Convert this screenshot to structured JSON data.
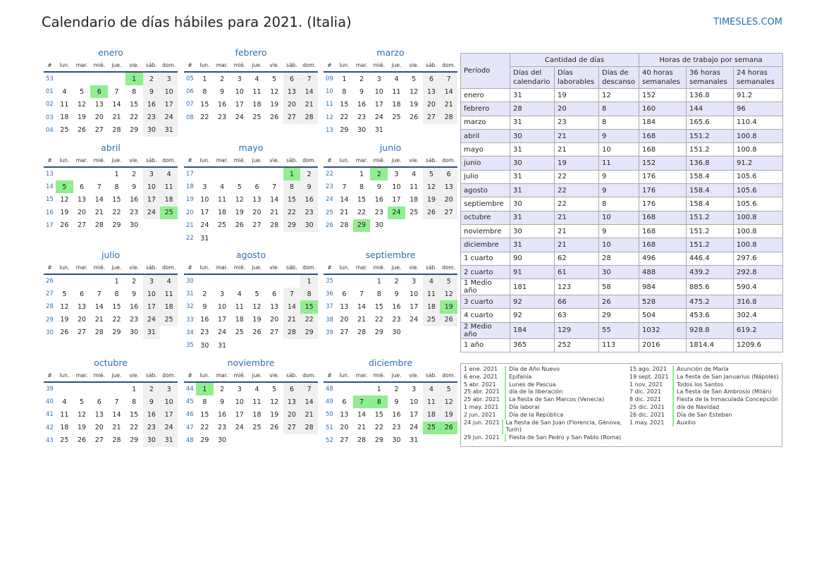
{
  "header": {
    "title": "Calendario de días hábiles para 2021. (Italia)",
    "site": "TIMESLES.COM"
  },
  "weekday_headers": [
    "#",
    "lun.",
    "mar.",
    "mié.",
    "jue.",
    "vie.",
    "sáb.",
    "dom."
  ],
  "months": [
    {
      "name": "enero",
      "weeks": [
        [
          "53",
          "",
          "",
          "",
          "",
          "1",
          "2",
          "3"
        ],
        [
          "01",
          "4",
          "5",
          "6",
          "7",
          "8",
          "9",
          "10"
        ],
        [
          "02",
          "11",
          "12",
          "13",
          "14",
          "15",
          "16",
          "17"
        ],
        [
          "03",
          "18",
          "19",
          "20",
          "21",
          "22",
          "23",
          "24"
        ],
        [
          "04",
          "25",
          "26",
          "27",
          "28",
          "29",
          "30",
          "31"
        ]
      ],
      "holidays": [
        "1",
        "6"
      ]
    },
    {
      "name": "febrero",
      "weeks": [
        [
          "05",
          "1",
          "2",
          "3",
          "4",
          "5",
          "6",
          "7"
        ],
        [
          "06",
          "8",
          "9",
          "10",
          "11",
          "12",
          "13",
          "14"
        ],
        [
          "07",
          "15",
          "16",
          "17",
          "18",
          "19",
          "20",
          "21"
        ],
        [
          "08",
          "22",
          "23",
          "24",
          "25",
          "26",
          "27",
          "28"
        ]
      ],
      "holidays": []
    },
    {
      "name": "marzo",
      "weeks": [
        [
          "09",
          "1",
          "2",
          "3",
          "4",
          "5",
          "6",
          "7"
        ],
        [
          "10",
          "8",
          "9",
          "10",
          "11",
          "12",
          "13",
          "14"
        ],
        [
          "11",
          "15",
          "16",
          "17",
          "18",
          "19",
          "20",
          "21"
        ],
        [
          "12",
          "22",
          "23",
          "24",
          "25",
          "26",
          "27",
          "28"
        ],
        [
          "13",
          "29",
          "30",
          "31",
          "",
          "",
          "",
          ""
        ]
      ],
      "holidays": []
    },
    {
      "name": "abril",
      "weeks": [
        [
          "13",
          "",
          "",
          "",
          "1",
          "2",
          "3",
          "4"
        ],
        [
          "14",
          "5",
          "6",
          "7",
          "8",
          "9",
          "10",
          "11"
        ],
        [
          "15",
          "12",
          "13",
          "14",
          "15",
          "16",
          "17",
          "18"
        ],
        [
          "16",
          "19",
          "20",
          "21",
          "22",
          "23",
          "24",
          "25"
        ],
        [
          "17",
          "26",
          "27",
          "28",
          "29",
          "30",
          "",
          ""
        ]
      ],
      "holidays": [
        "5",
        "25"
      ]
    },
    {
      "name": "mayo",
      "weeks": [
        [
          "17",
          "",
          "",
          "",
          "",
          "",
          "1",
          "2"
        ],
        [
          "18",
          "3",
          "4",
          "5",
          "6",
          "7",
          "8",
          "9"
        ],
        [
          "19",
          "10",
          "11",
          "12",
          "13",
          "14",
          "15",
          "16"
        ],
        [
          "20",
          "17",
          "18",
          "19",
          "20",
          "21",
          "22",
          "23"
        ],
        [
          "21",
          "24",
          "25",
          "26",
          "27",
          "28",
          "29",
          "30"
        ],
        [
          "22",
          "31",
          "",
          "",
          "",
          "",
          "",
          ""
        ]
      ],
      "holidays": [
        "1"
      ]
    },
    {
      "name": "junio",
      "weeks": [
        [
          "22",
          "",
          "1",
          "2",
          "3",
          "4",
          "5",
          "6"
        ],
        [
          "23",
          "7",
          "8",
          "9",
          "10",
          "11",
          "12",
          "13"
        ],
        [
          "24",
          "14",
          "15",
          "16",
          "17",
          "18",
          "19",
          "20"
        ],
        [
          "25",
          "21",
          "22",
          "23",
          "24",
          "25",
          "26",
          "27"
        ],
        [
          "26",
          "28",
          "29",
          "30",
          "",
          "",
          "",
          ""
        ]
      ],
      "holidays": [
        "2",
        "24",
        "29"
      ]
    },
    {
      "name": "julio",
      "weeks": [
        [
          "26",
          "",
          "",
          "",
          "1",
          "2",
          "3",
          "4"
        ],
        [
          "27",
          "5",
          "6",
          "7",
          "8",
          "9",
          "10",
          "11"
        ],
        [
          "28",
          "12",
          "13",
          "14",
          "15",
          "16",
          "17",
          "18"
        ],
        [
          "29",
          "19",
          "20",
          "21",
          "22",
          "23",
          "24",
          "25"
        ],
        [
          "30",
          "26",
          "27",
          "28",
          "29",
          "30",
          "31",
          ""
        ]
      ],
      "holidays": []
    },
    {
      "name": "agosto",
      "weeks": [
        [
          "30",
          "",
          "",
          "",
          "",
          "",
          "",
          "1"
        ],
        [
          "31",
          "2",
          "3",
          "4",
          "5",
          "6",
          "7",
          "8"
        ],
        [
          "32",
          "9",
          "10",
          "11",
          "12",
          "13",
          "14",
          "15"
        ],
        [
          "33",
          "16",
          "17",
          "18",
          "19",
          "20",
          "21",
          "22"
        ],
        [
          "34",
          "23",
          "24",
          "25",
          "26",
          "27",
          "28",
          "29"
        ],
        [
          "35",
          "30",
          "31",
          "",
          "",
          "",
          "",
          ""
        ]
      ],
      "holidays": [
        "15"
      ]
    },
    {
      "name": "septiembre",
      "weeks": [
        [
          "35",
          "",
          "",
          "1",
          "2",
          "3",
          "4",
          "5"
        ],
        [
          "36",
          "6",
          "7",
          "8",
          "9",
          "10",
          "11",
          "12"
        ],
        [
          "37",
          "13",
          "14",
          "15",
          "16",
          "17",
          "18",
          "19"
        ],
        [
          "38",
          "20",
          "21",
          "22",
          "23",
          "24",
          "25",
          "26"
        ],
        [
          "39",
          "27",
          "28",
          "29",
          "30",
          "",
          "",
          ""
        ]
      ],
      "holidays": [
        "19"
      ]
    },
    {
      "name": "octubre",
      "weeks": [
        [
          "39",
          "",
          "",
          "",
          "",
          "1",
          "2",
          "3"
        ],
        [
          "40",
          "4",
          "5",
          "6",
          "7",
          "8",
          "9",
          "10"
        ],
        [
          "41",
          "11",
          "12",
          "13",
          "14",
          "15",
          "16",
          "17"
        ],
        [
          "42",
          "18",
          "19",
          "20",
          "21",
          "22",
          "23",
          "24"
        ],
        [
          "43",
          "25",
          "26",
          "27",
          "28",
          "29",
          "30",
          "31"
        ]
      ],
      "holidays": []
    },
    {
      "name": "noviembre",
      "weeks": [
        [
          "44",
          "1",
          "2",
          "3",
          "4",
          "5",
          "6",
          "7"
        ],
        [
          "45",
          "8",
          "9",
          "10",
          "11",
          "12",
          "13",
          "14"
        ],
        [
          "46",
          "15",
          "16",
          "17",
          "18",
          "19",
          "20",
          "21"
        ],
        [
          "47",
          "22",
          "23",
          "24",
          "25",
          "26",
          "27",
          "28"
        ],
        [
          "48",
          "29",
          "30",
          "",
          "",
          "",
          "",
          ""
        ]
      ],
      "holidays": [
        "1"
      ]
    },
    {
      "name": "diciembre",
      "weeks": [
        [
          "48",
          "",
          "",
          "1",
          "2",
          "3",
          "4",
          "5"
        ],
        [
          "49",
          "6",
          "7",
          "8",
          "9",
          "10",
          "11",
          "12"
        ],
        [
          "50",
          "13",
          "14",
          "15",
          "16",
          "17",
          "18",
          "19"
        ],
        [
          "51",
          "20",
          "21",
          "22",
          "23",
          "24",
          "25",
          "26"
        ],
        [
          "52",
          "27",
          "28",
          "29",
          "30",
          "31",
          "",
          ""
        ]
      ],
      "holidays": [
        "7",
        "8",
        "25",
        "26"
      ]
    }
  ],
  "summary": {
    "period_label": "Período",
    "days_group": "Cantidad de días",
    "hours_group": "Horas de trabajo por semana",
    "sub_headers": [
      "Días del calendario",
      "Días laborables",
      "Días de descanso",
      "40 horas semanales",
      "36 horas semanales",
      "24 horas semanales"
    ],
    "rows": [
      [
        "enero",
        "31",
        "19",
        "12",
        "152",
        "136.8",
        "91.2"
      ],
      [
        "febrero",
        "28",
        "20",
        "8",
        "160",
        "144",
        "96"
      ],
      [
        "marzo",
        "31",
        "23",
        "8",
        "184",
        "165.6",
        "110.4"
      ],
      [
        "abril",
        "30",
        "21",
        "9",
        "168",
        "151.2",
        "100.8"
      ],
      [
        "mayo",
        "31",
        "21",
        "10",
        "168",
        "151.2",
        "100.8"
      ],
      [
        "junio",
        "30",
        "19",
        "11",
        "152",
        "136.8",
        "91.2"
      ],
      [
        "julio",
        "31",
        "22",
        "9",
        "176",
        "158.4",
        "105.6"
      ],
      [
        "agosto",
        "31",
        "22",
        "9",
        "176",
        "158.4",
        "105.6"
      ],
      [
        "septiembre",
        "30",
        "22",
        "8",
        "176",
        "158.4",
        "105.6"
      ],
      [
        "octubre",
        "31",
        "21",
        "10",
        "168",
        "151.2",
        "100.8"
      ],
      [
        "noviembre",
        "30",
        "21",
        "9",
        "168",
        "151.2",
        "100.8"
      ],
      [
        "diciembre",
        "31",
        "21",
        "10",
        "168",
        "151.2",
        "100.8"
      ],
      [
        "1 cuarto",
        "90",
        "62",
        "28",
        "496",
        "446.4",
        "297.6"
      ],
      [
        "2 cuarto",
        "91",
        "61",
        "30",
        "488",
        "439.2",
        "292.8"
      ],
      [
        "1 Medio año",
        "181",
        "123",
        "58",
        "984",
        "885.6",
        "590.4"
      ],
      [
        "3 cuarto",
        "92",
        "66",
        "26",
        "528",
        "475.2",
        "316.8"
      ],
      [
        "4 cuarto",
        "92",
        "63",
        "29",
        "504",
        "453.6",
        "302.4"
      ],
      [
        "2 Medio año",
        "184",
        "129",
        "55",
        "1032",
        "928.8",
        "619.2"
      ],
      [
        "1 año",
        "365",
        "252",
        "113",
        "2016",
        "1814.4",
        "1209.6"
      ]
    ]
  },
  "holidays_left": [
    {
      "date": "1 ene. 2021",
      "name": "Día de Año Nuevo"
    },
    {
      "date": "6 ene. 2021",
      "name": "Epifanía"
    },
    {
      "date": "5 abr. 2021",
      "name": "Lunes de Pascua"
    },
    {
      "date": "25 abr. 2021",
      "name": "día de la liberación"
    },
    {
      "date": "25 abr. 2021",
      "name": "La fiesta de San Marcos (Venecia)"
    },
    {
      "date": "1 may. 2021",
      "name": "Día laboral"
    },
    {
      "date": "2 jun. 2021",
      "name": "Día de la República"
    },
    {
      "date": "24 jun. 2021",
      "name": "La fiesta de San Juan (Florencia, Génova, Turín)"
    },
    {
      "date": "29 jun. 2021",
      "name": "Fiesta de San Pedro y San Pablo (Roma)"
    }
  ],
  "holidays_right": [
    {
      "date": "15 ago. 2021",
      "name": "Asunción de María"
    },
    {
      "date": "19 sept. 2021",
      "name": "La fiesta de San Januarius (Nápoles)"
    },
    {
      "date": "1 nov. 2021",
      "name": "Todos los Santos"
    },
    {
      "date": "7 dic. 2021",
      "name": "La fiesta de San Ambrosio (Milán)"
    },
    {
      "date": "8 dic. 2021",
      "name": "Fiesta de la Inmaculada Concepción"
    },
    {
      "date": "25 dic. 2021",
      "name": "día de Navidad"
    },
    {
      "date": "26 dic. 2021",
      "name": "Día de San Esteban"
    },
    {
      "date": "1 may. 2021",
      "name": "Auxilio"
    }
  ]
}
